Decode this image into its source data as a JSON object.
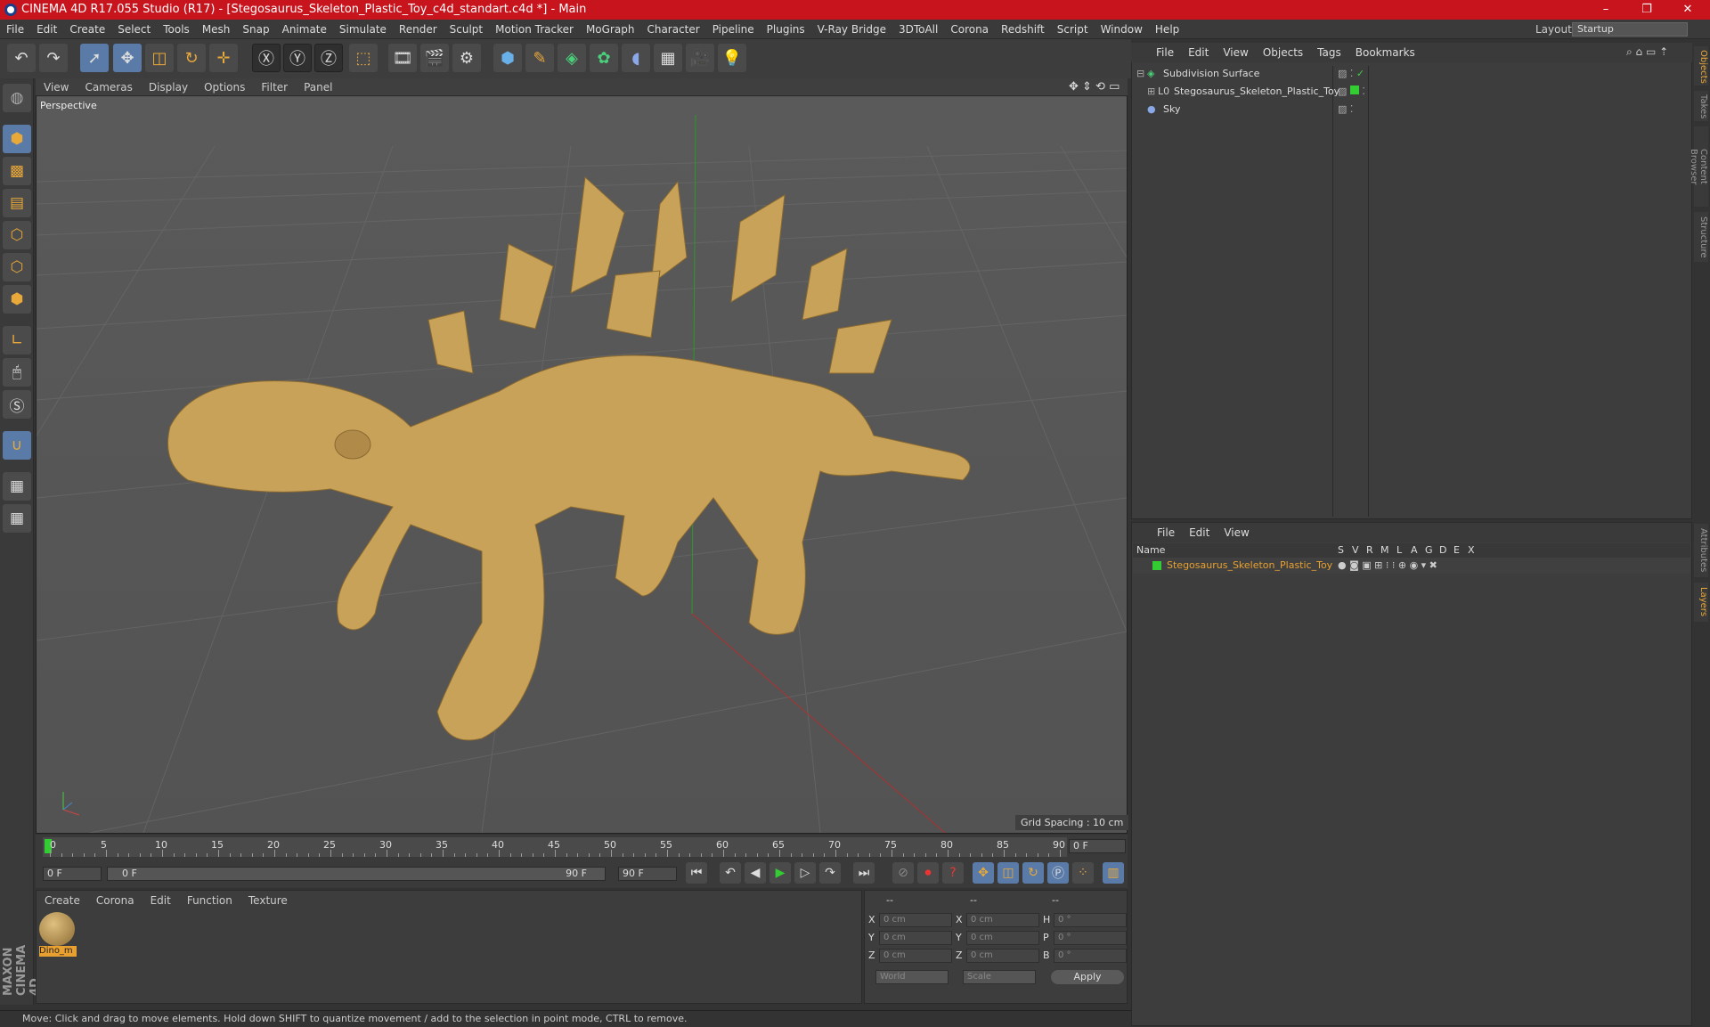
{
  "window": {
    "title": "CINEMA 4D R17.055 Studio (R17) - [Stegosaurus_Skeleton_Plastic_Toy_c4d_standart.c4d *] - Main",
    "controls": [
      "–",
      "❐",
      "✕"
    ]
  },
  "menubar": {
    "items": [
      "File",
      "Edit",
      "Create",
      "Select",
      "Tools",
      "Mesh",
      "Snap",
      "Animate",
      "Simulate",
      "Render",
      "Sculpt",
      "Motion Tracker",
      "MoGraph",
      "Character",
      "Pipeline",
      "Plugins",
      "V-Ray Bridge",
      "3DToAll",
      "Corona",
      "Redshift",
      "Script",
      "Window",
      "Help"
    ],
    "layout_label": "Layout:",
    "layout_value": "Startup"
  },
  "viewport": {
    "menu": [
      "View",
      "Cameras",
      "Display",
      "Options",
      "Filter",
      "Panel"
    ],
    "camera_label": "Perspective",
    "grid_spacing": "Grid Spacing : 10 cm"
  },
  "timeline": {
    "ticks": [
      "0",
      "5",
      "10",
      "15",
      "20",
      "25",
      "30",
      "35",
      "40",
      "45",
      "50",
      "55",
      "60",
      "65",
      "70",
      "75",
      "80",
      "85",
      "90"
    ],
    "current_frame": "0 F"
  },
  "transport": {
    "start_field": "0 F",
    "slider_start": "0 F",
    "slider_end": "90 F",
    "end_field": "90 F"
  },
  "materials": {
    "menu": [
      "Create",
      "Corona",
      "Edit",
      "Function",
      "Texture"
    ],
    "items": [
      {
        "name": "Dino_m"
      }
    ]
  },
  "coordinates": {
    "headers": [
      "--",
      "--",
      "--"
    ],
    "rows": [
      {
        "a": "X",
        "av": "0 cm",
        "b": "X",
        "bv": "0 cm",
        "c": "H",
        "cv": "0 °"
      },
      {
        "a": "Y",
        "av": "0 cm",
        "b": "Y",
        "bv": "0 cm",
        "c": "P",
        "cv": "0 °"
      },
      {
        "a": "Z",
        "av": "0 cm",
        "b": "Z",
        "bv": "0 cm",
        "c": "B",
        "cv": "0 °"
      }
    ],
    "space_select": "World",
    "mode_select": "Scale",
    "apply_label": "Apply"
  },
  "status": {
    "text": "Move: Click and drag to move elements. Hold down SHIFT to quantize movement / add to the selection in point mode, CTRL to remove."
  },
  "objects": {
    "menu": [
      "File",
      "Edit",
      "View",
      "Objects",
      "Tags",
      "Bookmarks"
    ],
    "tree": [
      {
        "name": "Subdivision Surface",
        "color": "#ffffff"
      },
      {
        "name": "Stegosaurus_Skeleton_Plastic_Toy",
        "color": "#dddddd"
      },
      {
        "name": "Sky",
        "color": "#dddddd"
      }
    ]
  },
  "layers": {
    "menu": [
      "File",
      "Edit",
      "View"
    ],
    "columns": [
      "Name",
      "S",
      "V",
      "R",
      "M",
      "L",
      "A",
      "G",
      "D",
      "E",
      "X"
    ],
    "rows": [
      {
        "name": "Stegosaurus_Skeleton_Plastic_Toy",
        "color": "#e8a030"
      }
    ]
  },
  "right_tabs": [
    "Objects",
    "Takes",
    "Content Browser",
    "Structure",
    "Attributes",
    "Layers"
  ],
  "brand": {
    "text": "MAXON CINEMA 4D"
  }
}
